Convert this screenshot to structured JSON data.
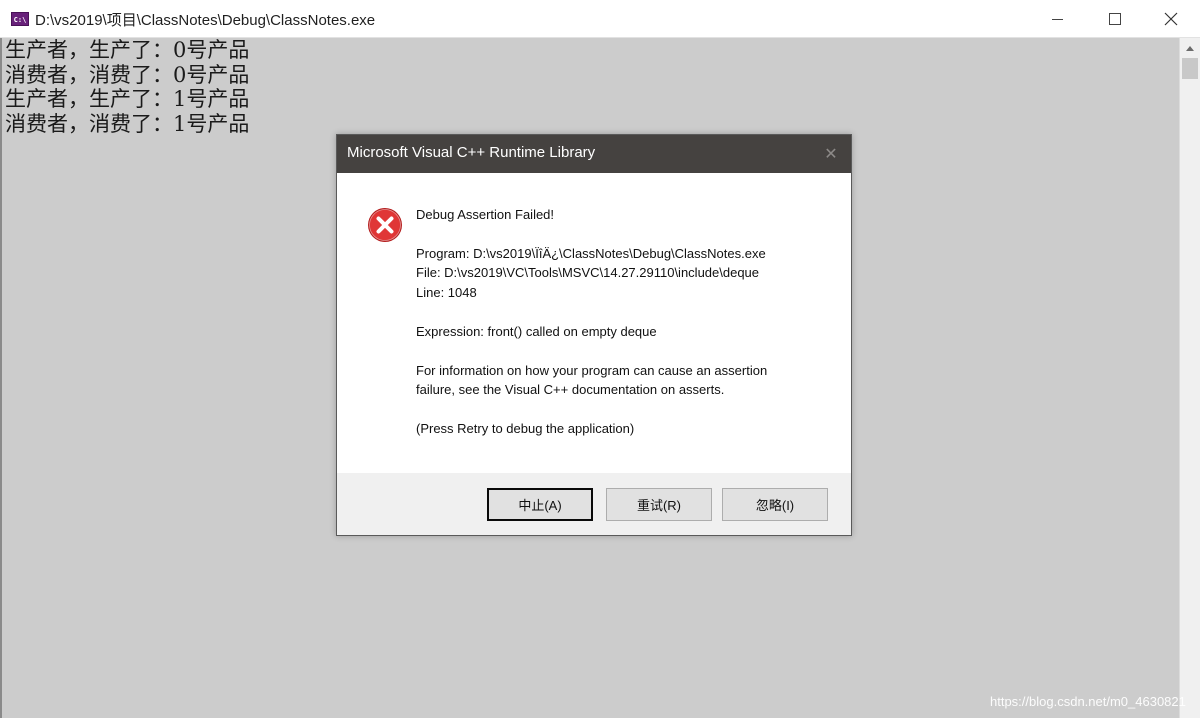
{
  "window": {
    "title": "D:\\vs2019\\项目\\ClassNotes\\Debug\\ClassNotes.exe",
    "icon_text": "C:\\",
    "controls": {
      "minimize": "minimize-icon",
      "maximize": "maximize-icon",
      "close": "close-icon"
    }
  },
  "console": {
    "lines": [
      "生产者，生产了：0号产品",
      "消费者，消费了：0号产品",
      "生产者，生产了：1号产品",
      "消费者，消费了：1号产品"
    ]
  },
  "dialog": {
    "title": "Microsoft Visual C++ Runtime Library",
    "close_glyph": "✕",
    "icon": "error-icon",
    "heading": "Debug Assertion Failed!",
    "program": "Program: D:\\vs2019\\ÏîÄ¿\\ClassNotes\\Debug\\ClassNotes.exe",
    "file": "File: D:\\vs2019\\VC\\Tools\\MSVC\\14.27.29110\\include\\deque",
    "line": "Line: 1048",
    "expression": "Expression: front() called on empty deque",
    "info_line1": "For information on how your program can cause an assertion",
    "info_line2": "failure, see the Visual C++ documentation on asserts.",
    "hint": "(Press Retry to debug the application)",
    "buttons": {
      "abort": "中止(A)",
      "retry": "重试(R)",
      "ignore": "忽略(I)"
    }
  },
  "watermark": "https://blog.csdn.net/m0_4630821",
  "colors": {
    "console_bg": "#cccccc",
    "dialog_titlebar": "#454240",
    "error_red": "#d92b2b"
  }
}
